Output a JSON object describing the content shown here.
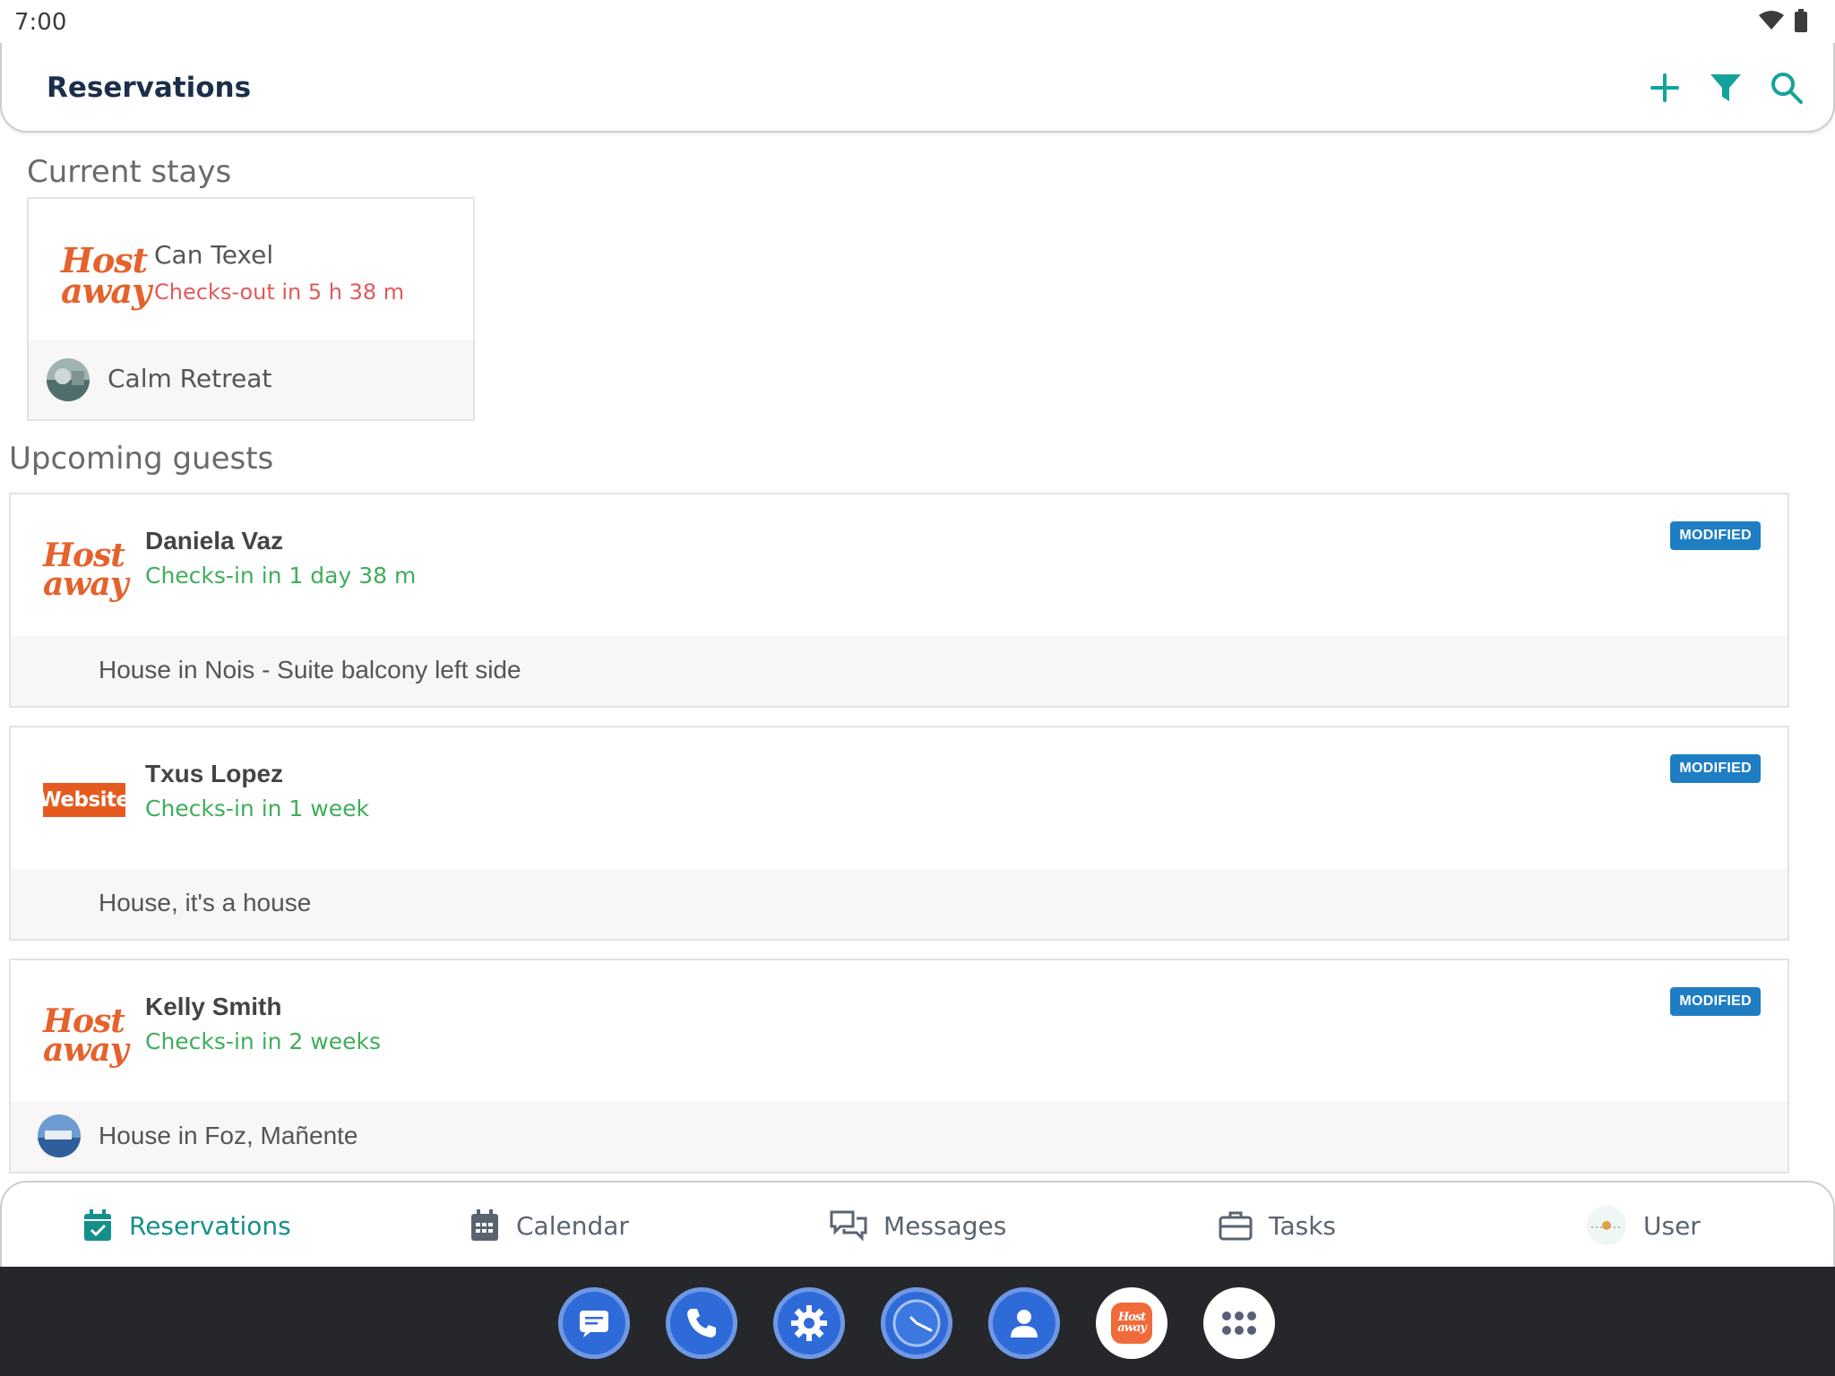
{
  "status_bar": {
    "time": "7:00"
  },
  "app_bar": {
    "title": "Reservations"
  },
  "current_stays": {
    "heading": "Current stays",
    "items": [
      {
        "logo_text": "Host away",
        "guest": "Can Texel",
        "status": "Checks-out in 5 h 38 m",
        "property": "Calm Retreat"
      }
    ]
  },
  "upcoming": {
    "heading": "Upcoming guests",
    "items": [
      {
        "logo": "hostaway",
        "logo_text": "Host away",
        "guest": "Daniela Vaz",
        "status": "Checks-in in 1 day 38 m",
        "badge": "MODIFIED",
        "property": "House in Nois - Suite balcony left side"
      },
      {
        "logo": "website",
        "logo_text": "Website",
        "guest": "Txus Lopez",
        "status": "Checks-in in 1 week",
        "badge": "MODIFIED",
        "property": "House, it's a house"
      },
      {
        "logo": "hostaway",
        "logo_text": "Host away",
        "guest": "Kelly Smith",
        "status": "Checks-in in 2 weeks",
        "badge": "MODIFIED",
        "property": "House in Foz, Mañente"
      }
    ]
  },
  "bottom_nav": {
    "reservations": "Reservations",
    "calendar": "Calendar",
    "messages": "Messages",
    "tasks": "Tasks",
    "user": "User"
  },
  "dock": {
    "hostaway_logo_text": "Host away"
  },
  "colors": {
    "accent": "#14908a",
    "checkout": "#e05a5a",
    "checkin": "#3fae5a",
    "badge": "#1f7ec3",
    "brand_orange": "#e5622c"
  }
}
